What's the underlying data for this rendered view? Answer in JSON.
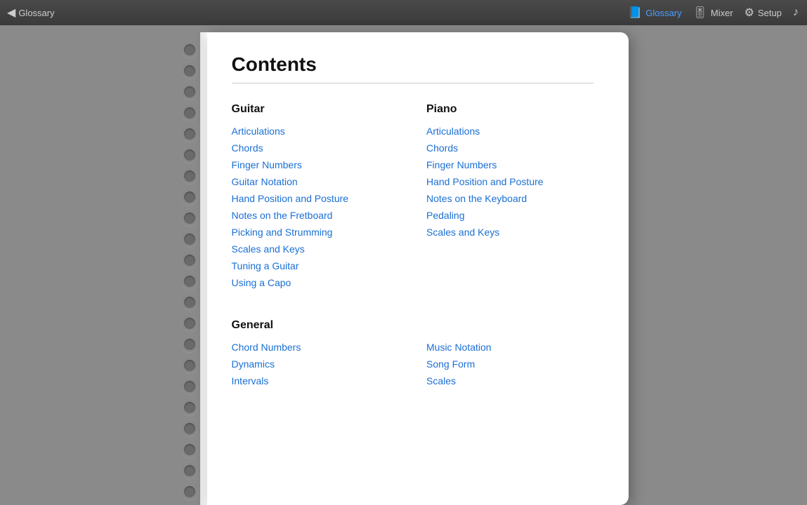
{
  "topbar": {
    "back_label": "Glossary",
    "nav_items": [
      {
        "id": "glossary",
        "label": "Glossary",
        "active": true,
        "icon": "📘"
      },
      {
        "id": "mixer",
        "label": "Mixer",
        "active": false,
        "icon": "🎚"
      },
      {
        "id": "setup",
        "label": "Setup",
        "active": false,
        "icon": "⚙"
      },
      {
        "id": "music",
        "label": "",
        "active": false,
        "icon": "♪"
      }
    ]
  },
  "page": {
    "title": "Contents",
    "sections": [
      {
        "id": "guitar",
        "header": "Guitar",
        "links": [
          "Articulations",
          "Chords",
          "Finger Numbers",
          "Guitar Notation",
          "Hand Position and Posture",
          "Notes on the Fretboard",
          "Picking and Strumming",
          "Scales and Keys",
          "Tuning a Guitar",
          "Using a Capo"
        ]
      },
      {
        "id": "piano",
        "header": "Piano",
        "links": [
          "Articulations",
          "Chords",
          "Finger Numbers",
          "Hand Position and Posture",
          "Notes on the Keyboard",
          "Pedaling",
          "Scales and Keys"
        ]
      }
    ],
    "general_section": {
      "header": "General",
      "columns": [
        {
          "links": [
            "Chord Numbers",
            "Dynamics",
            "Intervals"
          ]
        },
        {
          "links": [
            "Music Notation",
            "Song Form",
            "Scales"
          ]
        }
      ]
    }
  },
  "spiral_count": 22
}
